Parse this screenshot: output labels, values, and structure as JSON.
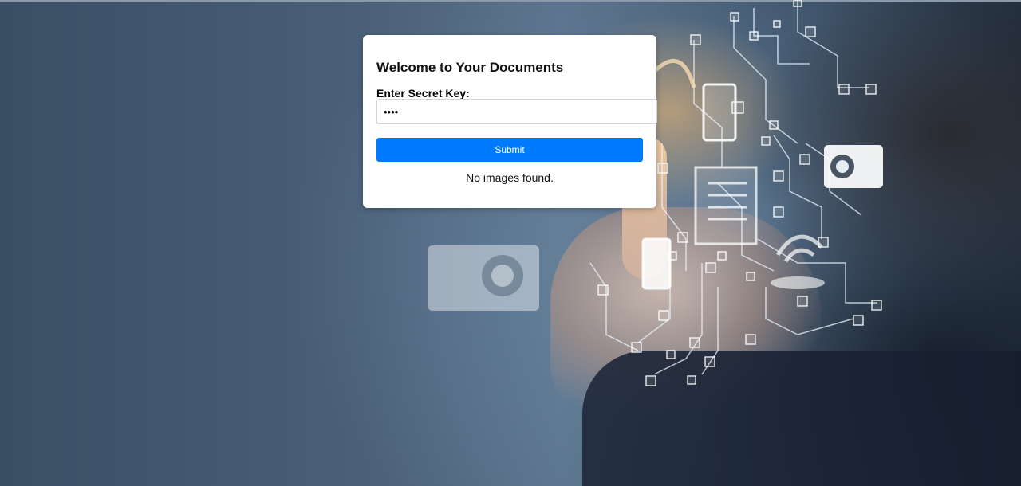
{
  "card": {
    "title": "Welcome to Your Documents",
    "key_label": "Enter Secret Key:",
    "key_value": "••••",
    "submit_label": "Submit",
    "status_message": "No images found."
  },
  "colors": {
    "button": "#007bff",
    "card_background": "#ffffff"
  },
  "background": {
    "description_icons": [
      "camera-icon",
      "phone-icon",
      "document-icon",
      "wifi-icon",
      "circuit-network"
    ]
  }
}
